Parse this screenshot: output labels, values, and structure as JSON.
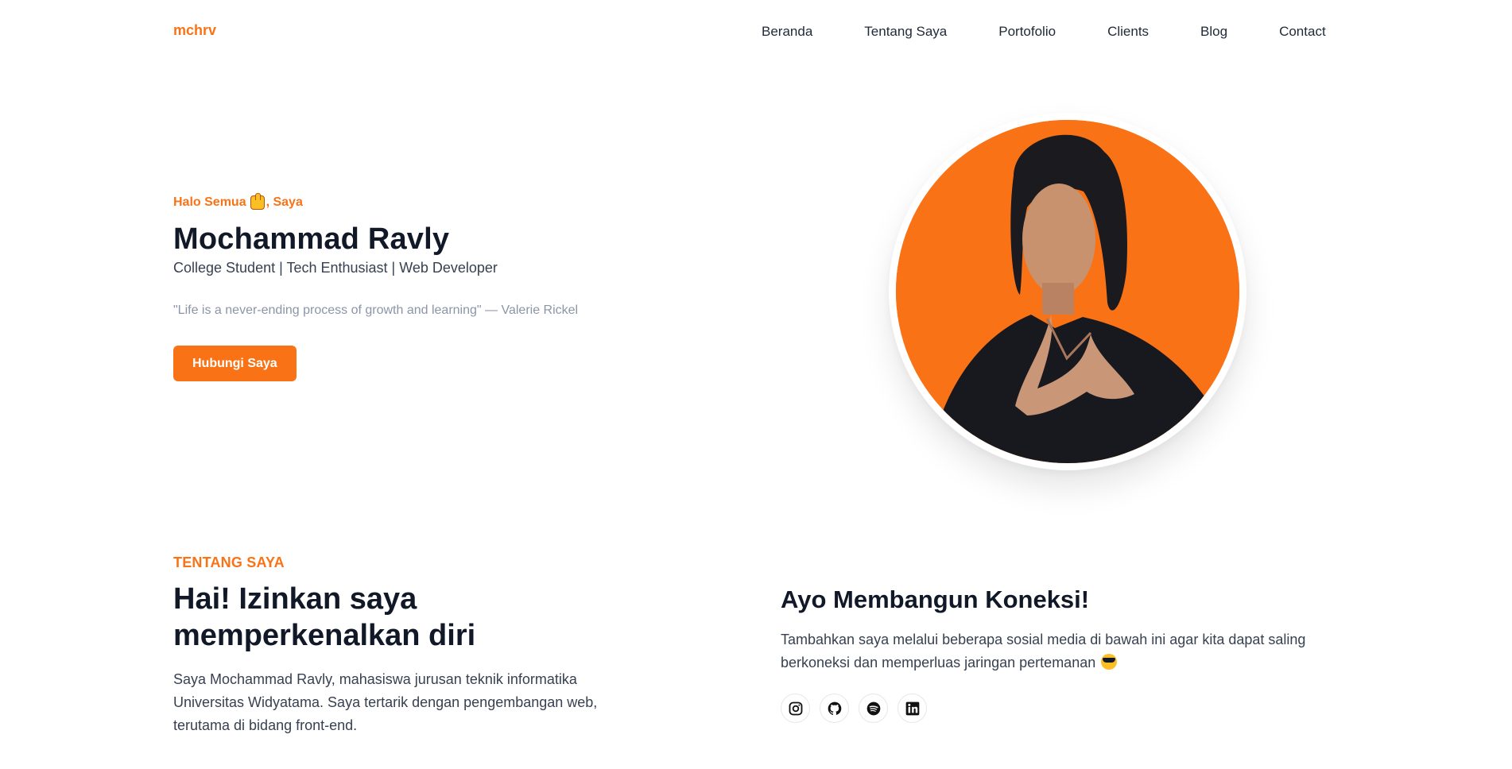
{
  "header": {
    "logo": "mchrv",
    "nav": [
      "Beranda",
      "Tentang Saya",
      "Portofolio",
      "Clients",
      "Blog",
      "Contact"
    ]
  },
  "hero": {
    "greeting_prefix": "Halo Semua",
    "greeting_suffix": ", Saya",
    "name": "Mochammad Ravly",
    "roles": "College Student | Tech Enthusiast | Web Developer",
    "quote": "\"Life is a never-ending process of growth and learning\" — Valerie Rickel",
    "cta": "Hubungi Saya"
  },
  "about": {
    "label": "TENTANG SAYA",
    "heading_line1": "Hai! Izinkan saya",
    "heading_line2": "memperkenalkan diri",
    "text": "Saya Mochammad Ravly, mahasiswa jurusan teknik informatika Universitas Widyatama. Saya tertarik dengan pengembangan web, terutama di bidang front-end."
  },
  "connect": {
    "heading": "Ayo Membangun Koneksi!",
    "text": "Tambahkan saya melalui beberapa sosial media di bawah ini agar kita dapat saling berkoneksi dan memperluas jaringan pertemanan",
    "social_icons": [
      "instagram-icon",
      "github-icon",
      "spotify-icon",
      "linkedin-icon"
    ]
  },
  "colors": {
    "accent": "#f97316",
    "heading": "#111827",
    "body": "#374151",
    "muted": "#8b95a7"
  }
}
